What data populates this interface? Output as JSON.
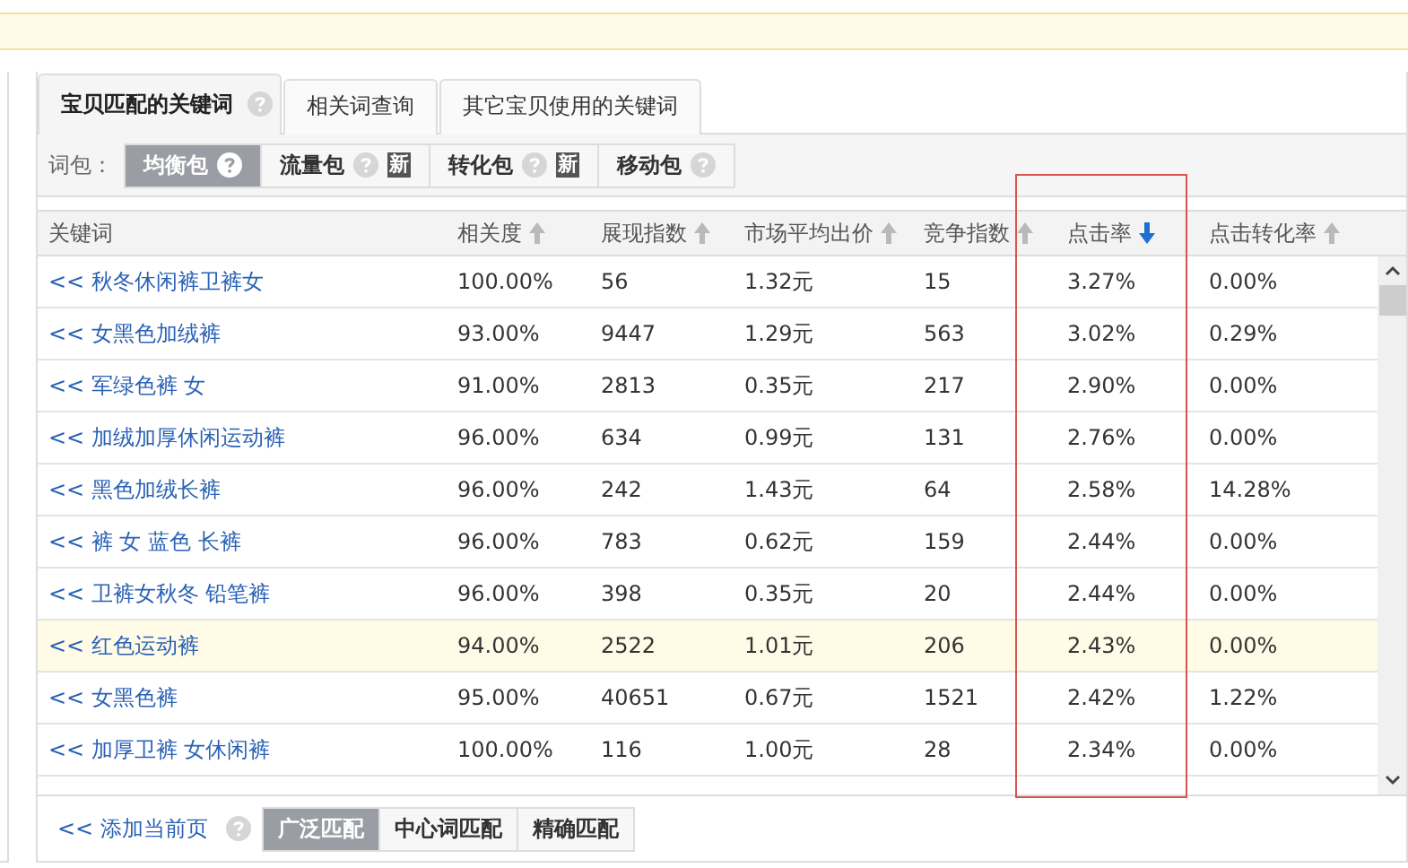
{
  "tabs": [
    {
      "label": "宝贝匹配的关键词",
      "help": true,
      "selected": true
    },
    {
      "label": "相关词查询",
      "help": false,
      "selected": false
    },
    {
      "label": "其它宝贝使用的关键词",
      "help": false,
      "selected": false
    }
  ],
  "word_packs": {
    "label": "词包：",
    "items": [
      {
        "label": "均衡包",
        "help": true,
        "selected": true
      },
      {
        "label": "流量包",
        "help": true,
        "badge": "新",
        "selected": false
      },
      {
        "label": "转化包",
        "help": true,
        "badge": "新",
        "selected": false
      },
      {
        "label": "移动包",
        "help": true,
        "selected": false
      }
    ]
  },
  "table": {
    "columns": [
      {
        "label": "关键词",
        "sortable": false,
        "active": false
      },
      {
        "label": "相关度",
        "sortable": true,
        "active": false
      },
      {
        "label": "展现指数",
        "sortable": true,
        "active": false
      },
      {
        "label": "市场平均出价",
        "sortable": true,
        "active": false
      },
      {
        "label": "竞争指数",
        "sortable": true,
        "active": false
      },
      {
        "label": "点击率",
        "sortable": true,
        "active": true
      },
      {
        "label": "点击转化率",
        "sortable": true,
        "active": false
      }
    ],
    "rows": [
      {
        "selected": false,
        "cells": [
          "<< 秋冬休闲裤卫裤女",
          "100.00%",
          "56",
          "1.32元",
          "15",
          "3.27%",
          "0.00%"
        ]
      },
      {
        "selected": false,
        "cells": [
          "<< 女黑色加绒裤",
          "93.00%",
          "9447",
          "1.29元",
          "563",
          "3.02%",
          "0.29%"
        ]
      },
      {
        "selected": false,
        "cells": [
          "<< 军绿色裤 女",
          "91.00%",
          "2813",
          "0.35元",
          "217",
          "2.90%",
          "0.00%"
        ]
      },
      {
        "selected": false,
        "cells": [
          "<< 加绒加厚休闲运动裤",
          "96.00%",
          "634",
          "0.99元",
          "131",
          "2.76%",
          "0.00%"
        ]
      },
      {
        "selected": false,
        "cells": [
          "<< 黑色加绒长裤",
          "96.00%",
          "242",
          "1.43元",
          "64",
          "2.58%",
          "14.28%"
        ]
      },
      {
        "selected": false,
        "cells": [
          "<< 裤 女 蓝色 长裤",
          "96.00%",
          "783",
          "0.62元",
          "159",
          "2.44%",
          "0.00%"
        ]
      },
      {
        "selected": false,
        "cells": [
          "<< 卫裤女秋冬 铅笔裤",
          "96.00%",
          "398",
          "0.35元",
          "20",
          "2.44%",
          "0.00%"
        ]
      },
      {
        "selected": true,
        "cells": [
          "<< 红色运动裤",
          "94.00%",
          "2522",
          "1.01元",
          "206",
          "2.43%",
          "0.00%"
        ]
      },
      {
        "selected": false,
        "cells": [
          "<< 女黑色裤",
          "95.00%",
          "40651",
          "0.67元",
          "1521",
          "2.42%",
          "1.22%"
        ]
      },
      {
        "selected": false,
        "cells": [
          "<< 加厚卫裤 女休闲裤",
          "100.00%",
          "116",
          "1.00元",
          "28",
          "2.34%",
          "0.00%"
        ]
      }
    ]
  },
  "footer": {
    "add_link": "<< 添加当前页",
    "help": true,
    "match_types": [
      {
        "label": "广泛匹配",
        "selected": true
      },
      {
        "label": "中心词匹配",
        "selected": false
      },
      {
        "label": "精确匹配",
        "selected": false
      }
    ]
  }
}
